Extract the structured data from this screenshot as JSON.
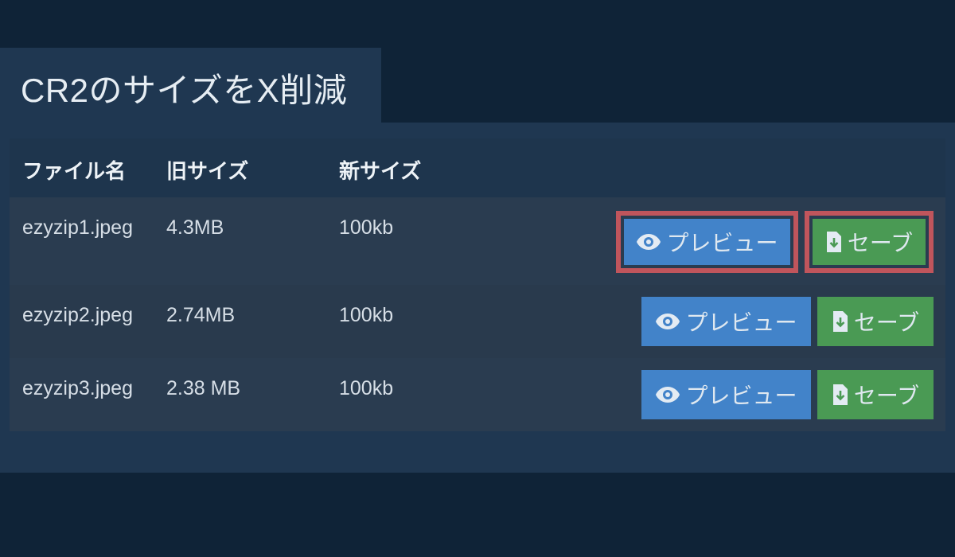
{
  "title": "CR2のサイズをX削減",
  "table": {
    "headers": {
      "file_name": "ファイル名",
      "old_size": "旧サイズ",
      "new_size": "新サイズ"
    },
    "rows": [
      {
        "file_name": "ezyzip1.jpeg",
        "old_size": "4.3MB",
        "new_size": "100kb",
        "preview_label": "プレビュー",
        "save_label": "セーブ",
        "highlighted": true
      },
      {
        "file_name": "ezyzip2.jpeg",
        "old_size": "2.74MB",
        "new_size": "100kb",
        "preview_label": "プレビュー",
        "save_label": "セーブ",
        "highlighted": false
      },
      {
        "file_name": "ezyzip3.jpeg",
        "old_size": "2.38 MB",
        "new_size": "100kb",
        "preview_label": "プレビュー",
        "save_label": "セーブ",
        "highlighted": false
      }
    ]
  },
  "icons": {
    "preview": "eye-icon",
    "save": "file-download-icon"
  },
  "colors": {
    "background": "#0f2337",
    "panel": "#1f3751",
    "preview_button": "#4283c9",
    "save_button": "#4a9a54",
    "highlight": "#c0555c"
  }
}
